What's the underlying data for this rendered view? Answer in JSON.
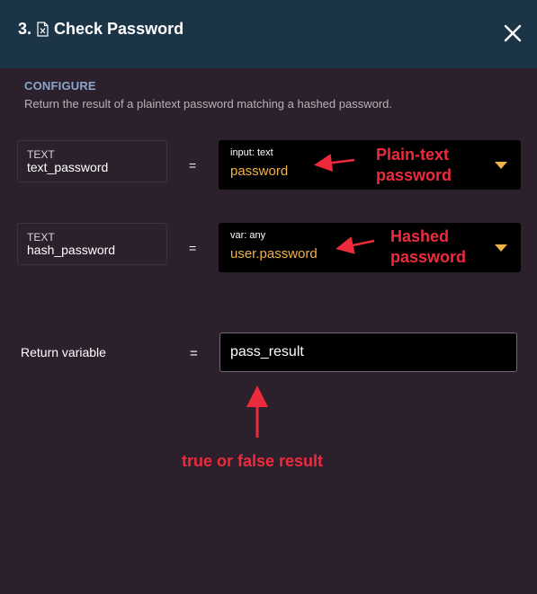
{
  "header": {
    "step": "3.",
    "title": "Check Password",
    "icon": "document-x-icon",
    "close_icon": "close-icon"
  },
  "configure": {
    "label": "CONFIGURE",
    "description": "Return the result of a plaintext password matching a hashed password."
  },
  "params": [
    {
      "type": "TEXT",
      "name": "text_password",
      "equals": "=",
      "value_type": "input: text",
      "value": "password",
      "annotation": [
        "Plain-text",
        "password"
      ]
    },
    {
      "type": "TEXT",
      "name": "hash_password",
      "equals": "=",
      "value_type": "var: any",
      "value": "user.password",
      "annotation": [
        "Hashed",
        "password"
      ]
    }
  ],
  "return": {
    "label": "Return variable",
    "equals": "=",
    "value": "pass_result",
    "annotation": "true or false result"
  },
  "colors": {
    "header_bg": "#1b3446",
    "panel_bg": "#2b202b",
    "accent_value": "#f0b24a",
    "annotation_red": "#ee2b3c",
    "section_label": "#8aa6c8"
  }
}
